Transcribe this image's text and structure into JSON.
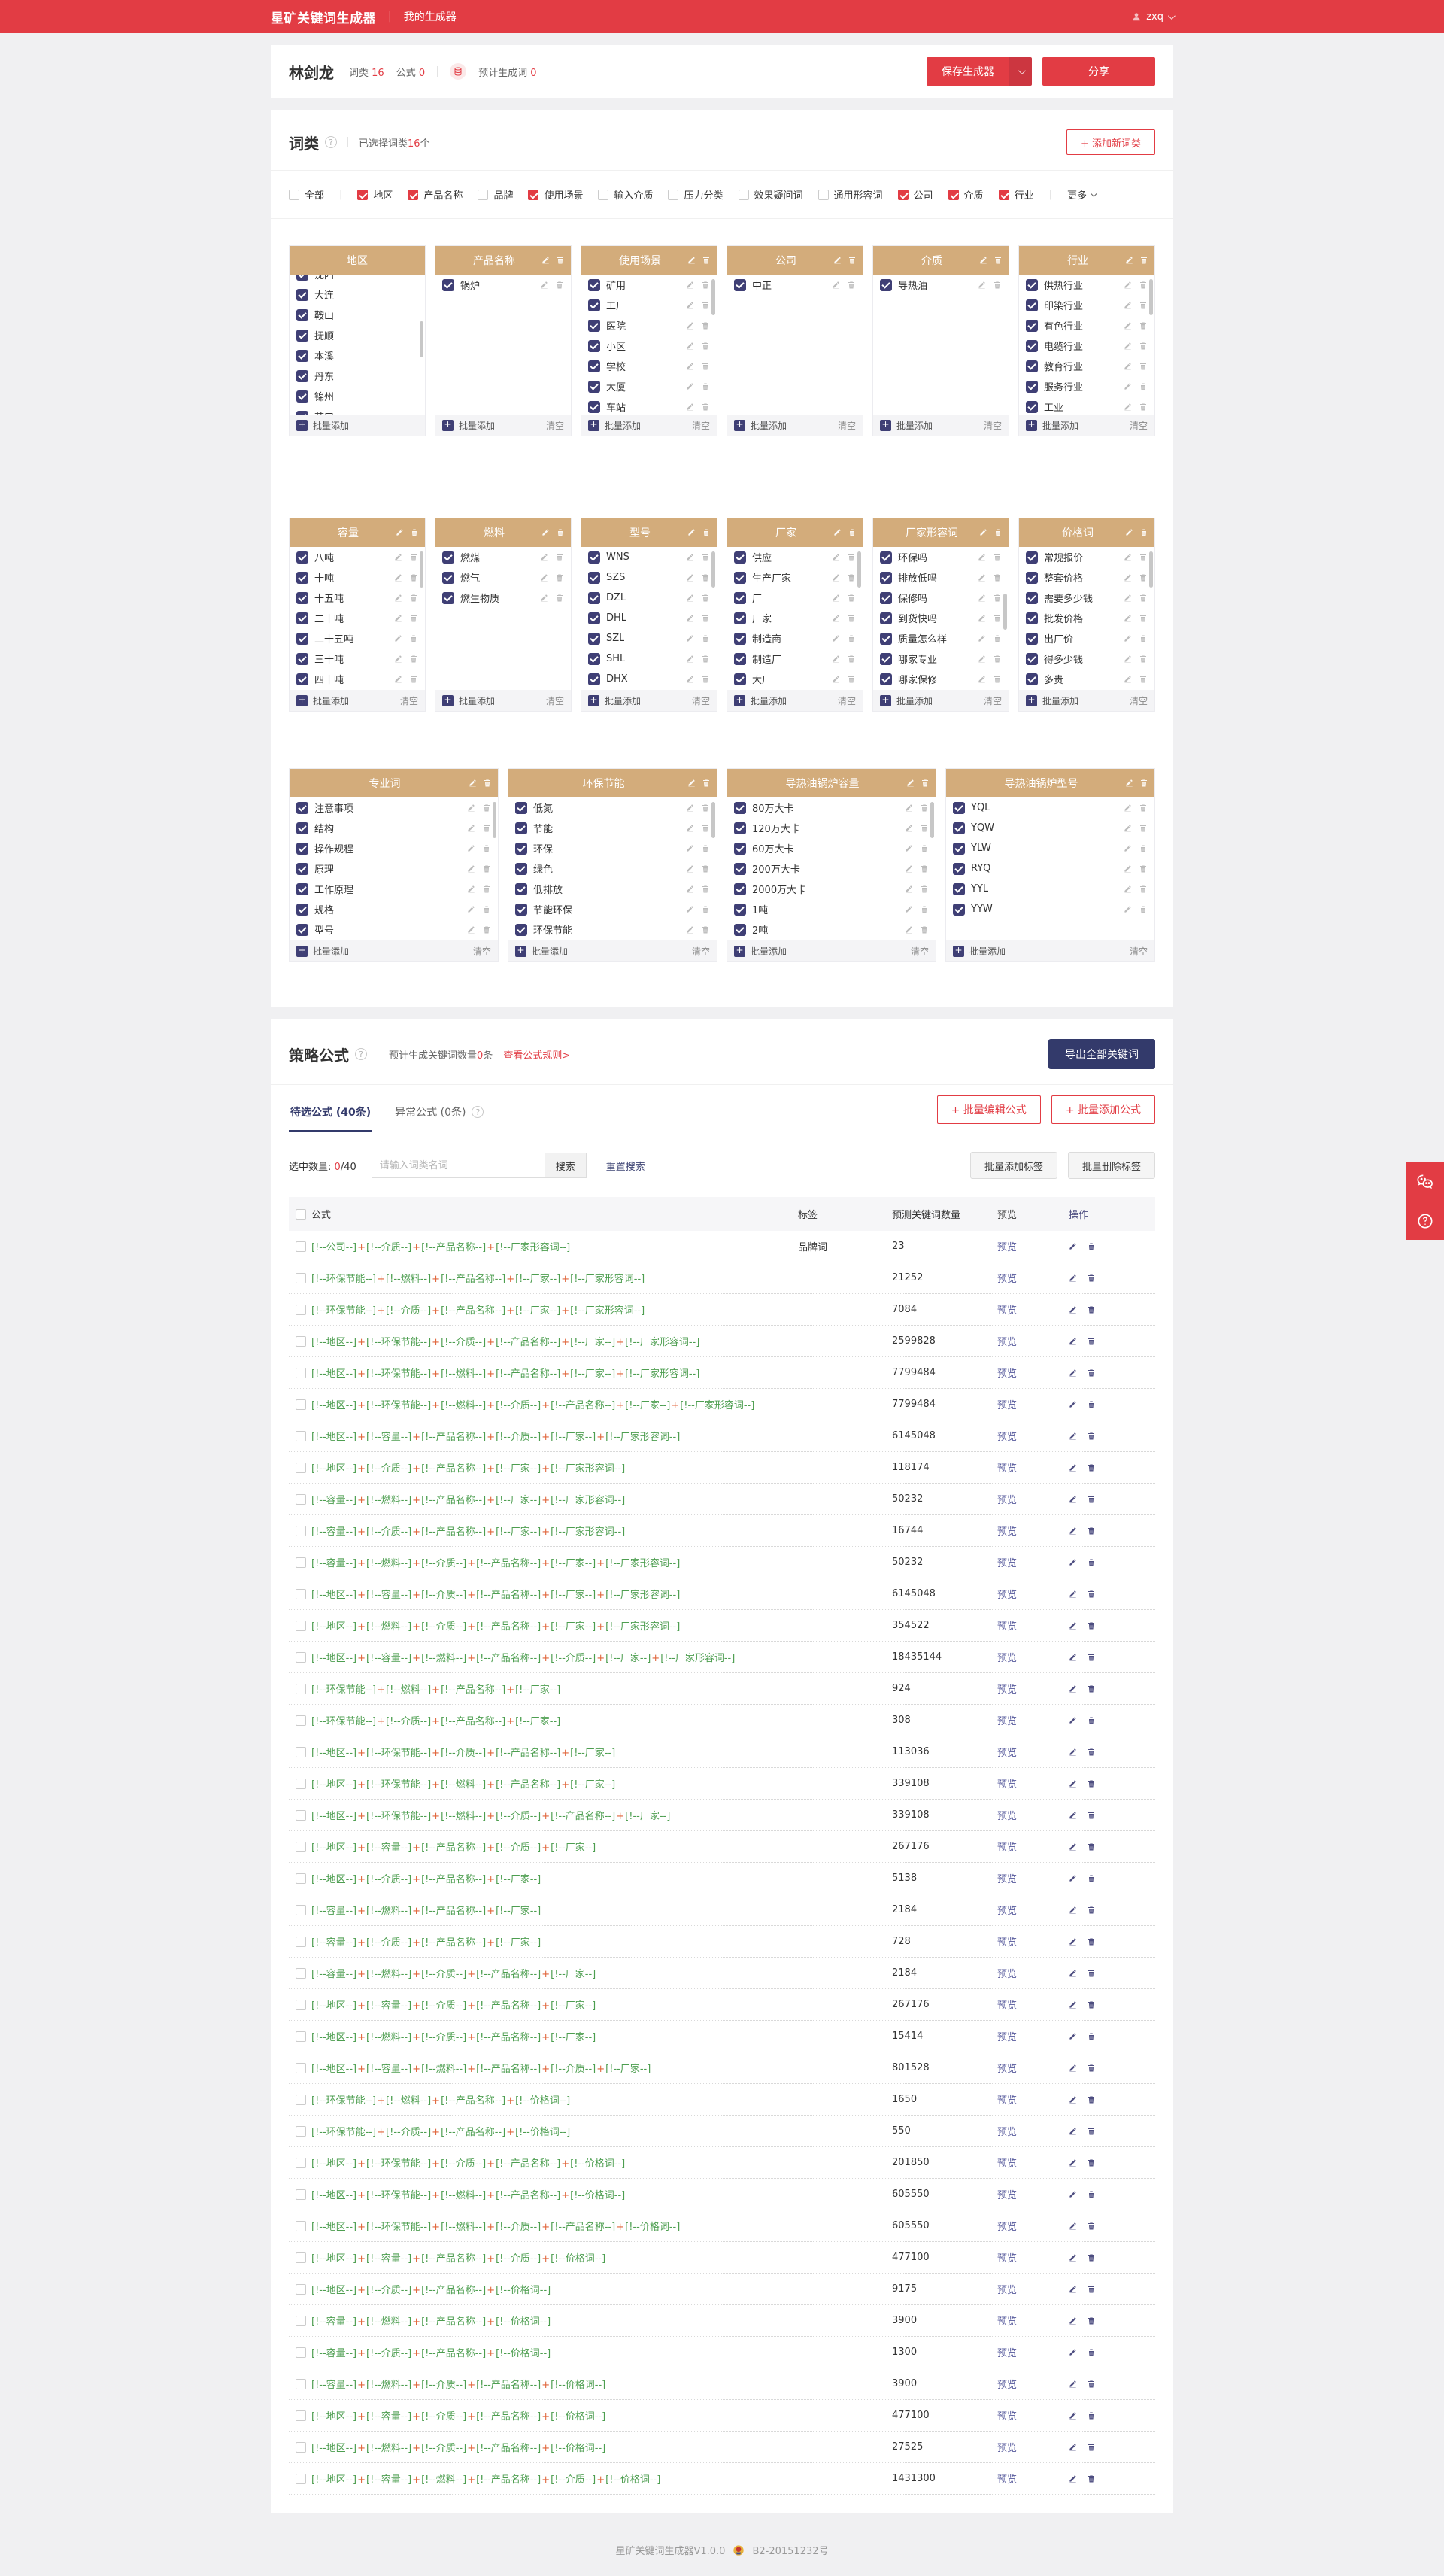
{
  "colors": {
    "accent_red": "#e23c44",
    "header_tan": "#d3ac7b",
    "check_navy": "#3f3f75",
    "export_navy": "#333a6b",
    "token_green": "#4d9e50",
    "plus_orange": "#e0663c"
  },
  "topbar": {
    "logo": "星矿关键词生成器",
    "nav": "我的生成器",
    "user": "zxq"
  },
  "profile": {
    "name": "林剑龙",
    "wordclass_label": "词类",
    "wordclass_count": "16",
    "formula_label": "公式",
    "formula_count": "0",
    "estimate_label": "预计生成词",
    "estimate_count": "0",
    "save_button": "保存生成器",
    "share_button": "分享"
  },
  "wordclass_section": {
    "title": "词类",
    "selected_prefix": "已选择词类",
    "selected_count": "16",
    "selected_suffix": "个",
    "add_button": "+ 添加新词类",
    "more_label": "更多",
    "batch_add_label": "批量添加",
    "clear_label": "清空",
    "filters": [
      {
        "label": "全部",
        "checked": false
      },
      {
        "label": "地区",
        "checked": true
      },
      {
        "label": "产品名称",
        "checked": true
      },
      {
        "label": "品牌",
        "checked": false
      },
      {
        "label": "使用场景",
        "checked": true
      },
      {
        "label": "输入介质",
        "checked": false
      },
      {
        "label": "压力分类",
        "checked": false
      },
      {
        "label": "效果疑问词",
        "checked": false
      },
      {
        "label": "通用形容词",
        "checked": false
      },
      {
        "label": "公司",
        "checked": true
      },
      {
        "label": "介质",
        "checked": true
      },
      {
        "label": "行业",
        "checked": true
      }
    ],
    "rows": [
      [
        {
          "title": "地区",
          "header_icons": false,
          "item_icons": false,
          "scrollbar": true,
          "scroll_pos": "mid",
          "top_partial": "沈阳",
          "items": [
            "大连",
            "鞍山",
            "抚顺",
            "本溪",
            "丹东",
            "锦州"
          ],
          "bottom_partial": "营口",
          "clear": false
        },
        {
          "title": "产品名称",
          "header_icons": true,
          "item_icons": true,
          "scrollbar": false,
          "items": [
            "锅炉"
          ],
          "clear": true
        },
        {
          "title": "使用场景",
          "header_icons": true,
          "item_icons": true,
          "scrollbar": true,
          "scroll_pos": "top",
          "items": [
            "矿用",
            "工厂",
            "医院",
            "小区",
            "学校",
            "大厦"
          ],
          "bottom_partial": "车站",
          "clear": true
        },
        {
          "title": "公司",
          "header_icons": true,
          "item_icons": true,
          "scrollbar": false,
          "items": [
            "中正"
          ],
          "clear": true
        },
        {
          "title": "介质",
          "header_icons": true,
          "item_icons": true,
          "scrollbar": false,
          "items": [
            "导热油"
          ],
          "clear": true
        },
        {
          "title": "行业",
          "header_icons": true,
          "item_icons": true,
          "scrollbar": true,
          "scroll_pos": "top",
          "items": [
            "供热行业",
            "印染行业",
            "有色行业",
            "电缆行业",
            "教育行业",
            "服务行业"
          ],
          "bottom_partial": "工业",
          "clear": true
        }
      ],
      [
        {
          "title": "容量",
          "header_icons": true,
          "item_icons": true,
          "scrollbar": true,
          "scroll_pos": "top",
          "items": [
            "八吨",
            "十吨",
            "十五吨",
            "二十吨",
            "二十五吨",
            "三十吨",
            "四十吨"
          ],
          "clear": true
        },
        {
          "title": "燃料",
          "header_icons": true,
          "item_icons": true,
          "scrollbar": false,
          "items": [
            "燃煤",
            "燃气",
            "燃生物质"
          ],
          "clear": true
        },
        {
          "title": "型号",
          "header_icons": true,
          "item_icons": true,
          "scrollbar": true,
          "scroll_pos": "top",
          "items": [
            "WNS",
            "SZS",
            "DZL",
            "DHL",
            "SZL",
            "SHL",
            "DHX"
          ],
          "clear": true
        },
        {
          "title": "厂家",
          "header_icons": true,
          "item_icons": true,
          "scrollbar": true,
          "scroll_pos": "top",
          "items": [
            "供应",
            "生产厂家",
            "厂",
            "厂家",
            "制造商",
            "制造厂",
            "大厂"
          ],
          "clear": true
        },
        {
          "title": "厂家形容词",
          "header_icons": true,
          "item_icons": true,
          "scrollbar": true,
          "scroll_pos": "mid",
          "items": [
            "环保吗",
            "排放低吗",
            "保修吗",
            "到货快吗",
            "质量怎么样",
            "哪家专业",
            "哪家保修"
          ],
          "clear": true
        },
        {
          "title": "价格词",
          "header_icons": true,
          "item_icons": true,
          "scrollbar": true,
          "scroll_pos": "top",
          "items": [
            "常规报价",
            "整套价格",
            "需要多少钱",
            "批发价格",
            "出厂价",
            "得多少钱",
            "多贵"
          ],
          "clear": true
        }
      ],
      [
        {
          "title": "专业词",
          "header_icons": true,
          "item_icons": true,
          "scrollbar": true,
          "scroll_pos": "top",
          "items": [
            "注意事项",
            "结构",
            "操作规程",
            "原理",
            "工作原理",
            "规格",
            "型号"
          ],
          "clear": true
        },
        {
          "title": "环保节能",
          "header_icons": true,
          "item_icons": true,
          "scrollbar": true,
          "scroll_pos": "top",
          "items": [
            "低氮",
            "节能",
            "环保",
            "绿色",
            "低排放",
            "节能环保",
            "环保节能"
          ],
          "clear": true
        },
        {
          "title": "导热油锅炉容量",
          "header_icons": true,
          "item_icons": true,
          "scrollbar": true,
          "scroll_pos": "top",
          "items": [
            "80万大卡",
            "120万大卡",
            "60万大卡",
            "200万大卡",
            "2000万大卡",
            "1吨",
            "2吨"
          ],
          "clear": true
        },
        {
          "title": "导热油锅炉型号",
          "header_icons": true,
          "item_icons": true,
          "scrollbar": false,
          "items": [
            "YQL",
            "YQW",
            "YLW",
            "RYQ",
            "YYL",
            "YYW"
          ],
          "clear": true
        }
      ]
    ]
  },
  "formula_section": {
    "title": "策略公式",
    "estimate_prefix": "预计生成关键词数量",
    "estimate_count": "0",
    "estimate_suffix": "条",
    "rules_link": "查看公式规则>",
    "export_button": "导出全部关键词",
    "tabs": [
      {
        "label": "待选公式 (40条)",
        "active": true,
        "help": false
      },
      {
        "label": "异常公式 (0条)",
        "active": false,
        "help": true
      }
    ],
    "batch_edit_button": "+ 批量编辑公式",
    "batch_add_button": "+ 批量添加公式",
    "selected_label": "选中数量:",
    "selected_zero": "0",
    "selected_total": "/40",
    "search_placeholder": "请输入词类名词",
    "search_button": "搜索",
    "reset_button": "重置搜索",
    "tag_add_button": "批量添加标签",
    "tag_del_button": "批量删除标签",
    "token_wrap": {
      "open": "[!--",
      "close": "--]",
      "joiner": "+"
    },
    "table": {
      "headers": {
        "formula": "公式",
        "tag": "标签",
        "count": "预测关键词数量",
        "preview": "预览",
        "ops": "操作"
      },
      "preview_label": "预览",
      "rows": [
        {
          "tokens": [
            "公司",
            "介质",
            "产品名称",
            "厂家形容词"
          ],
          "tag": "品牌词",
          "count": "23"
        },
        {
          "tokens": [
            "环保节能",
            "燃料",
            "产品名称",
            "厂家",
            "厂家形容词"
          ],
          "tag": "",
          "count": "21252"
        },
        {
          "tokens": [
            "环保节能",
            "介质",
            "产品名称",
            "厂家",
            "厂家形容词"
          ],
          "tag": "",
          "count": "7084"
        },
        {
          "tokens": [
            "地区",
            "环保节能",
            "介质",
            "产品名称",
            "厂家",
            "厂家形容词"
          ],
          "tag": "",
          "count": "2599828"
        },
        {
          "tokens": [
            "地区",
            "环保节能",
            "燃料",
            "产品名称",
            "厂家",
            "厂家形容词"
          ],
          "tag": "",
          "count": "7799484"
        },
        {
          "tokens": [
            "地区",
            "环保节能",
            "燃料",
            "介质",
            "产品名称",
            "厂家",
            "厂家形容词"
          ],
          "tag": "",
          "count": "7799484"
        },
        {
          "tokens": [
            "地区",
            "容量",
            "产品名称",
            "介质",
            "厂家",
            "厂家形容词"
          ],
          "tag": "",
          "count": "6145048"
        },
        {
          "tokens": [
            "地区",
            "介质",
            "产品名称",
            "厂家",
            "厂家形容词"
          ],
          "tag": "",
          "count": "118174"
        },
        {
          "tokens": [
            "容量",
            "燃料",
            "产品名称",
            "厂家",
            "厂家形容词"
          ],
          "tag": "",
          "count": "50232"
        },
        {
          "tokens": [
            "容量",
            "介质",
            "产品名称",
            "厂家",
            "厂家形容词"
          ],
          "tag": "",
          "count": "16744"
        },
        {
          "tokens": [
            "容量",
            "燃料",
            "介质",
            "产品名称",
            "厂家",
            "厂家形容词"
          ],
          "tag": "",
          "count": "50232"
        },
        {
          "tokens": [
            "地区",
            "容量",
            "介质",
            "产品名称",
            "厂家",
            "厂家形容词"
          ],
          "tag": "",
          "count": "6145048"
        },
        {
          "tokens": [
            "地区",
            "燃料",
            "介质",
            "产品名称",
            "厂家",
            "厂家形容词"
          ],
          "tag": "",
          "count": "354522"
        },
        {
          "tokens": [
            "地区",
            "容量",
            "燃料",
            "产品名称",
            "介质",
            "厂家",
            "厂家形容词"
          ],
          "tag": "",
          "count": "18435144"
        },
        {
          "tokens": [
            "环保节能",
            "燃料",
            "产品名称",
            "厂家"
          ],
          "tag": "",
          "count": "924"
        },
        {
          "tokens": [
            "环保节能",
            "介质",
            "产品名称",
            "厂家"
          ],
          "tag": "",
          "count": "308"
        },
        {
          "tokens": [
            "地区",
            "环保节能",
            "介质",
            "产品名称",
            "厂家"
          ],
          "tag": "",
          "count": "113036"
        },
        {
          "tokens": [
            "地区",
            "环保节能",
            "燃料",
            "产品名称",
            "厂家"
          ],
          "tag": "",
          "count": "339108"
        },
        {
          "tokens": [
            "地区",
            "环保节能",
            "燃料",
            "介质",
            "产品名称",
            "厂家"
          ],
          "tag": "",
          "count": "339108"
        },
        {
          "tokens": [
            "地区",
            "容量",
            "产品名称",
            "介质",
            "厂家"
          ],
          "tag": "",
          "count": "267176"
        },
        {
          "tokens": [
            "地区",
            "介质",
            "产品名称",
            "厂家"
          ],
          "tag": "",
          "count": "5138"
        },
        {
          "tokens": [
            "容量",
            "燃料",
            "产品名称",
            "厂家"
          ],
          "tag": "",
          "count": "2184"
        },
        {
          "tokens": [
            "容量",
            "介质",
            "产品名称",
            "厂家"
          ],
          "tag": "",
          "count": "728"
        },
        {
          "tokens": [
            "容量",
            "燃料",
            "介质",
            "产品名称",
            "厂家"
          ],
          "tag": "",
          "count": "2184"
        },
        {
          "tokens": [
            "地区",
            "容量",
            "介质",
            "产品名称",
            "厂家"
          ],
          "tag": "",
          "count": "267176"
        },
        {
          "tokens": [
            "地区",
            "燃料",
            "介质",
            "产品名称",
            "厂家"
          ],
          "tag": "",
          "count": "15414"
        },
        {
          "tokens": [
            "地区",
            "容量",
            "燃料",
            "产品名称",
            "介质",
            "厂家"
          ],
          "tag": "",
          "count": "801528"
        },
        {
          "tokens": [
            "环保节能",
            "燃料",
            "产品名称",
            "价格词"
          ],
          "tag": "",
          "count": "1650"
        },
        {
          "tokens": [
            "环保节能",
            "介质",
            "产品名称",
            "价格词"
          ],
          "tag": "",
          "count": "550"
        },
        {
          "tokens": [
            "地区",
            "环保节能",
            "介质",
            "产品名称",
            "价格词"
          ],
          "tag": "",
          "count": "201850"
        },
        {
          "tokens": [
            "地区",
            "环保节能",
            "燃料",
            "产品名称",
            "价格词"
          ],
          "tag": "",
          "count": "605550"
        },
        {
          "tokens": [
            "地区",
            "环保节能",
            "燃料",
            "介质",
            "产品名称",
            "价格词"
          ],
          "tag": "",
          "count": "605550"
        },
        {
          "tokens": [
            "地区",
            "容量",
            "产品名称",
            "介质",
            "价格词"
          ],
          "tag": "",
          "count": "477100"
        },
        {
          "tokens": [
            "地区",
            "介质",
            "产品名称",
            "价格词"
          ],
          "tag": "",
          "count": "9175"
        },
        {
          "tokens": [
            "容量",
            "燃料",
            "产品名称",
            "价格词"
          ],
          "tag": "",
          "count": "3900"
        },
        {
          "tokens": [
            "容量",
            "介质",
            "产品名称",
            "价格词"
          ],
          "tag": "",
          "count": "1300"
        },
        {
          "tokens": [
            "容量",
            "燃料",
            "介质",
            "产品名称",
            "价格词"
          ],
          "tag": "",
          "count": "3900"
        },
        {
          "tokens": [
            "地区",
            "容量",
            "介质",
            "产品名称",
            "价格词"
          ],
          "tag": "",
          "count": "477100"
        },
        {
          "tokens": [
            "地区",
            "燃料",
            "介质",
            "产品名称",
            "价格词"
          ],
          "tag": "",
          "count": "27525"
        },
        {
          "tokens": [
            "地区",
            "容量",
            "燃料",
            "产品名称",
            "介质",
            "价格词"
          ],
          "tag": "",
          "count": "1431300"
        }
      ]
    }
  },
  "footer": {
    "version": "星矿关键词生成器V1.0.0",
    "icp": "B2-20151232号"
  }
}
